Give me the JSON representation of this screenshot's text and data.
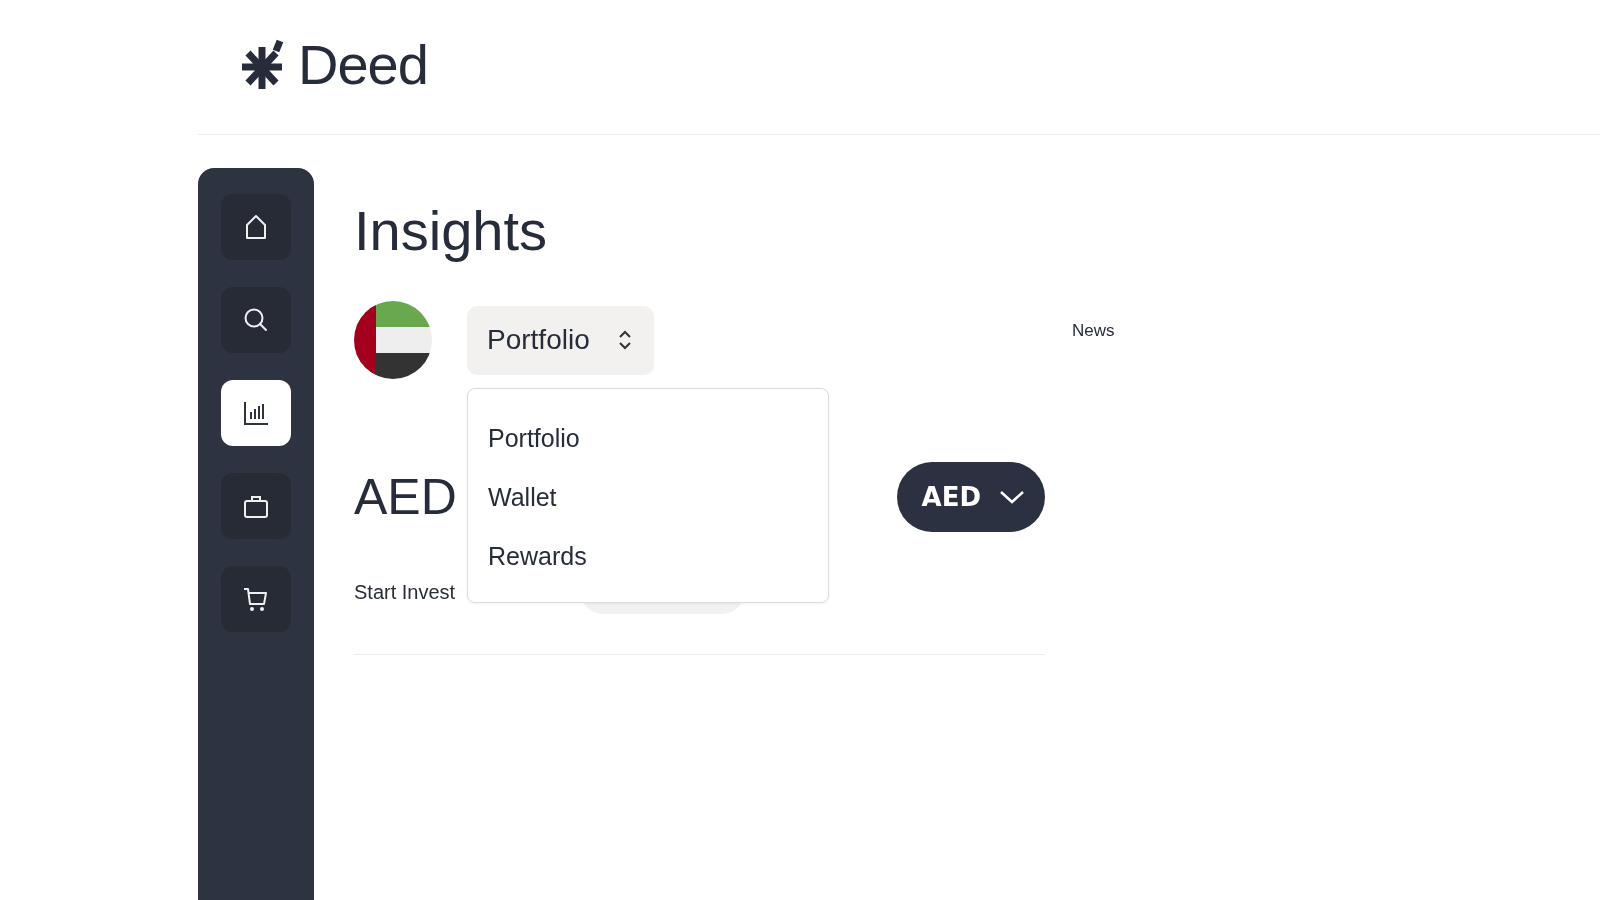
{
  "header": {
    "logo_text": "Deed"
  },
  "sidebar": {
    "items": [
      {
        "kind": "home",
        "selected": false
      },
      {
        "kind": "search",
        "selected": false
      },
      {
        "kind": "chart",
        "selected": true
      },
      {
        "kind": "bag",
        "selected": false
      },
      {
        "kind": "cart",
        "selected": false
      }
    ]
  },
  "page_title": "Insights",
  "view_select": {
    "value": "Portfolio",
    "expanded": true,
    "options": [
      {
        "label": "Portfolio"
      },
      {
        "label": "Wallet"
      },
      {
        "label": "Rewards"
      }
    ]
  },
  "balance": {
    "currency_label": "AED",
    "currency_button": "AED"
  },
  "invest": {
    "text": "Start Invest"
  },
  "news": {
    "title": "News"
  }
}
